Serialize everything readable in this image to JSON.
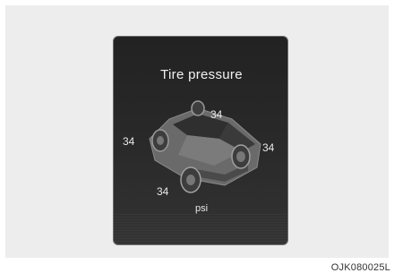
{
  "display": {
    "title": "Tire pressure",
    "unit": "psi",
    "pressures": {
      "front_left": "34",
      "front_right": "34",
      "rear_left": "34",
      "rear_right": "34"
    }
  },
  "figure_code": "OJK080025L"
}
